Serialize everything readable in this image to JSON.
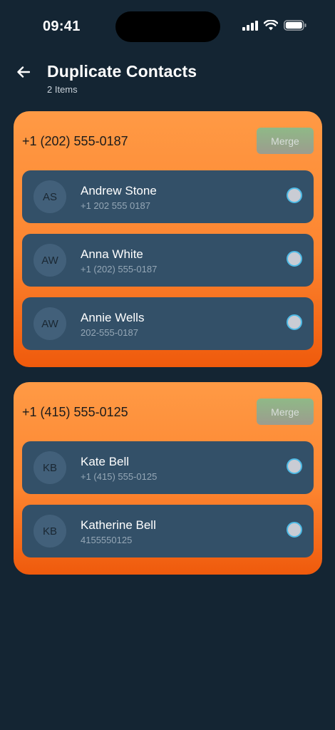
{
  "status_bar": {
    "time": "09:41",
    "icons": [
      "cellular-signal-icon",
      "wifi-icon",
      "battery-icon"
    ]
  },
  "header": {
    "back_icon": "arrow-left-icon",
    "title": "Duplicate Contacts",
    "subtitle": "2 Items"
  },
  "groups": [
    {
      "phone": "+1 (202) 555-0187",
      "merge_label": "Merge",
      "contacts": [
        {
          "initials": "AS",
          "name": "Andrew Stone",
          "number": "+1 202 555 0187"
        },
        {
          "initials": "AW",
          "name": "Anna White",
          "number": "+1 (202) 555-0187"
        },
        {
          "initials": "AW",
          "name": "Annie Wells",
          "number": "202-555-0187"
        }
      ]
    },
    {
      "phone": "+1 (415) 555-0125",
      "merge_label": "Merge",
      "contacts": [
        {
          "initials": "KB",
          "name": "Kate Bell",
          "number": "+1 (415) 555-0125"
        },
        {
          "initials": "KB",
          "name": "Katherine Bell",
          "number": "4155550125"
        }
      ]
    }
  ],
  "colors": {
    "background": "#142533",
    "card_gradient_top": "#ff9a45",
    "card_gradient_bottom": "#ef5a0c",
    "row_background": "#335068",
    "radio_border": "#4fbbe6"
  }
}
